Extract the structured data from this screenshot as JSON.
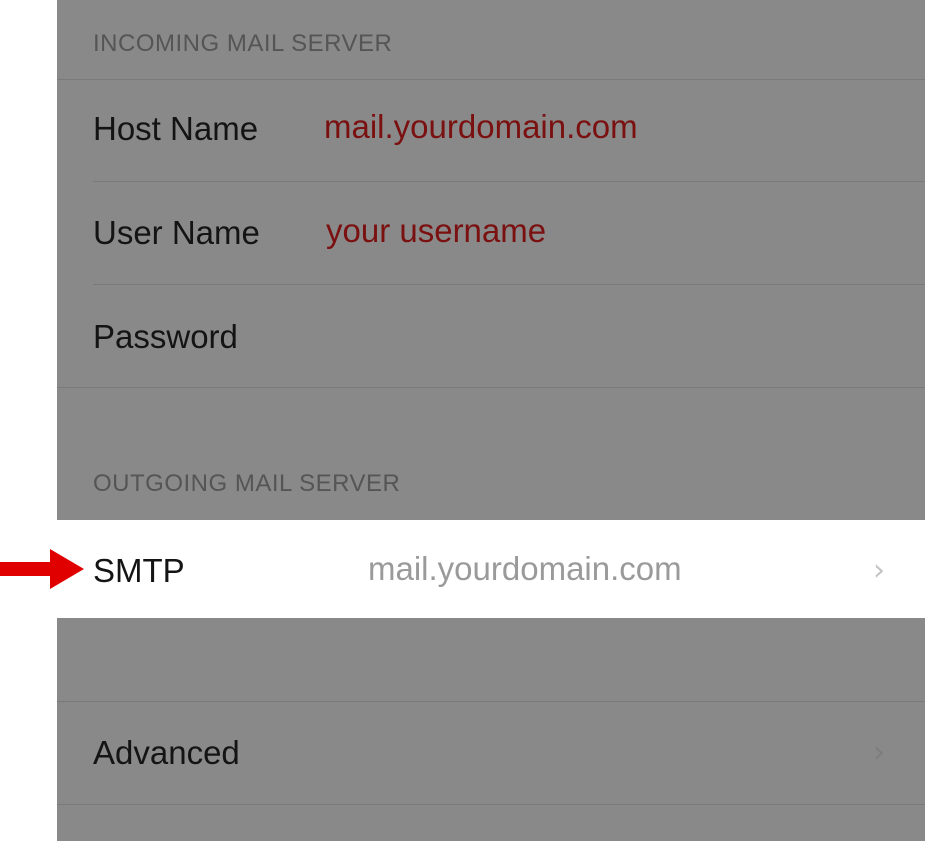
{
  "incoming": {
    "header": "INCOMING MAIL SERVER",
    "host_label": "Host Name",
    "host_value": "mail.yourdomain.com",
    "user_label": "User Name",
    "user_value": "your username",
    "password_label": "Password"
  },
  "outgoing": {
    "header": "OUTGOING MAIL SERVER",
    "smtp_label": "SMTP",
    "smtp_value": "mail.yourdomain.com"
  },
  "advanced": {
    "label": "Advanced"
  },
  "colors": {
    "overlay_gray": "#898989",
    "value_red": "#7a1010",
    "arrow_red": "#e00000",
    "highlight_white": "#ffffff"
  },
  "icons": {
    "smtp_chevron": "chevron-right-icon",
    "advanced_chevron": "chevron-right-icon",
    "pointer": "red-arrow-icon"
  }
}
